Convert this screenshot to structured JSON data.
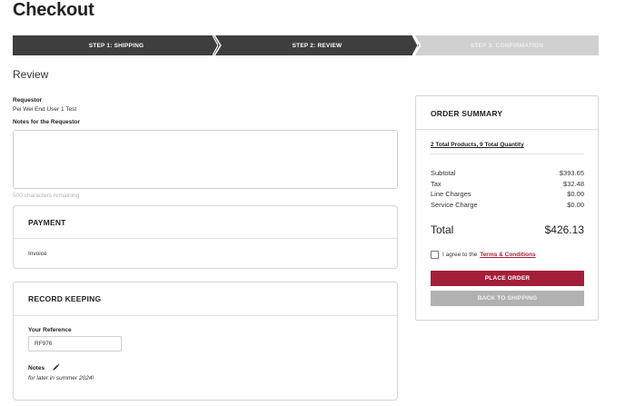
{
  "page": {
    "title": "Checkout",
    "section_title": "Review"
  },
  "steps": [
    {
      "label": "STEP 1: SHIPPING",
      "state": "complete"
    },
    {
      "label": "STEP 2: REVIEW",
      "state": "active"
    },
    {
      "label": "STEP 3: CONFIRMATION",
      "state": "pending"
    }
  ],
  "requestor": {
    "label": "Requestor",
    "value": "Pei Wei End User 1 Test",
    "notes_label": "Notes for the Requestor",
    "notes_value": "",
    "chars_remaining": "500 characters remaining"
  },
  "payment": {
    "title": "PAYMENT",
    "method": "Invoice"
  },
  "record_keeping": {
    "title": "RECORD KEEPING",
    "reference_label": "Your Reference",
    "reference_value": "RF976",
    "notes_label": "Notes",
    "notes_value": "for later in summer 2024!"
  },
  "summary": {
    "title": "ORDER SUMMARY",
    "totals_link": "2 Total Products, 9 Total Quantity",
    "lines": [
      {
        "label": "Subtotal",
        "value": "$393.65"
      },
      {
        "label": "Tax",
        "value": "$32.48"
      },
      {
        "label": "Line Charges",
        "value": "$0.00"
      },
      {
        "label": "Service Charge",
        "value": "$0.00"
      }
    ],
    "total_label": "Total",
    "total_value": "$426.13",
    "agree_text": "I agree to the",
    "terms_link": "Terms & Conditions",
    "place_order": "PLACE ORDER",
    "back_to_shipping": "BACK TO SHIPPING"
  },
  "colors": {
    "accent": "#a31f39",
    "step_active": "#3e3e3e",
    "step_pending": "#d0d0d0",
    "secondary_button": "#b1b1b1"
  }
}
